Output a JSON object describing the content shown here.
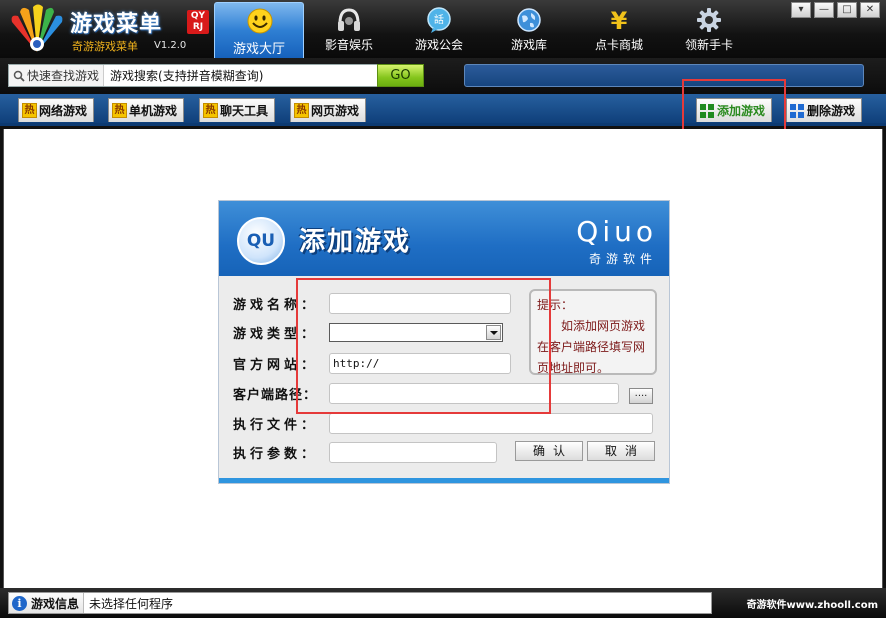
{
  "app": {
    "logo_title": "游戏菜单",
    "logo_badge": "QY RJ",
    "logo_subtitle": "奇游游戏菜单",
    "version": "V1.2.0"
  },
  "window_controls": {
    "menu": "▾",
    "minimize": "—",
    "maximize": "□",
    "close": "✕"
  },
  "nav": {
    "tabs": [
      {
        "label": "游戏大厅",
        "icon": "smiley-icon",
        "active": true
      },
      {
        "label": "影音娱乐",
        "icon": "headphones-icon"
      },
      {
        "label": "游戏公会",
        "icon": "chat-bubble-icon"
      },
      {
        "label": "游戏库",
        "icon": "globe-icon"
      },
      {
        "label": "点卡商城",
        "icon": "yen-icon"
      },
      {
        "label": "领新手卡",
        "icon": "gear-icon"
      }
    ]
  },
  "search": {
    "prefix_label": "快速查找游戏",
    "value": "游戏搜索(支持拼音模糊查询)",
    "go_label": "GO"
  },
  "categories": {
    "hot_badge": "热",
    "tabs": [
      "网络游戏",
      "单机游戏",
      "聊天工具",
      "网页游戏"
    ],
    "add_label": "添加游戏",
    "delete_label": "删除游戏"
  },
  "dialog": {
    "logo_text": "QU",
    "title": "添加游戏",
    "brand": "Qiuo",
    "brand_sub": "奇游软件",
    "fields": {
      "name_label": "游戏名称：",
      "name_value": "",
      "type_label": "游戏类型：",
      "type_value": "",
      "website_label": "官方网站：",
      "website_value": "http://",
      "client_path_label": "客户端路径：",
      "client_path_value": "",
      "exec_file_label": "执行文件：",
      "exec_file_value": "",
      "exec_params_label": "执行参数：",
      "exec_params_value": ""
    },
    "browse_label": "....",
    "hint_title": "提示：",
    "hint_text": "如添加网页游戏在客户端路径填写网页地址即可。",
    "confirm_label": "确认",
    "cancel_label": "取消"
  },
  "statusbar": {
    "info_label": "游戏信息",
    "message": "未选择任何程序",
    "brand": "奇游软件www.zhooll.com"
  },
  "colors": {
    "highlight": "#e53a3a",
    "brand_blue": "#1f6ec4",
    "go_green": "#84c51c",
    "hint_text": "#7d1a1a"
  }
}
